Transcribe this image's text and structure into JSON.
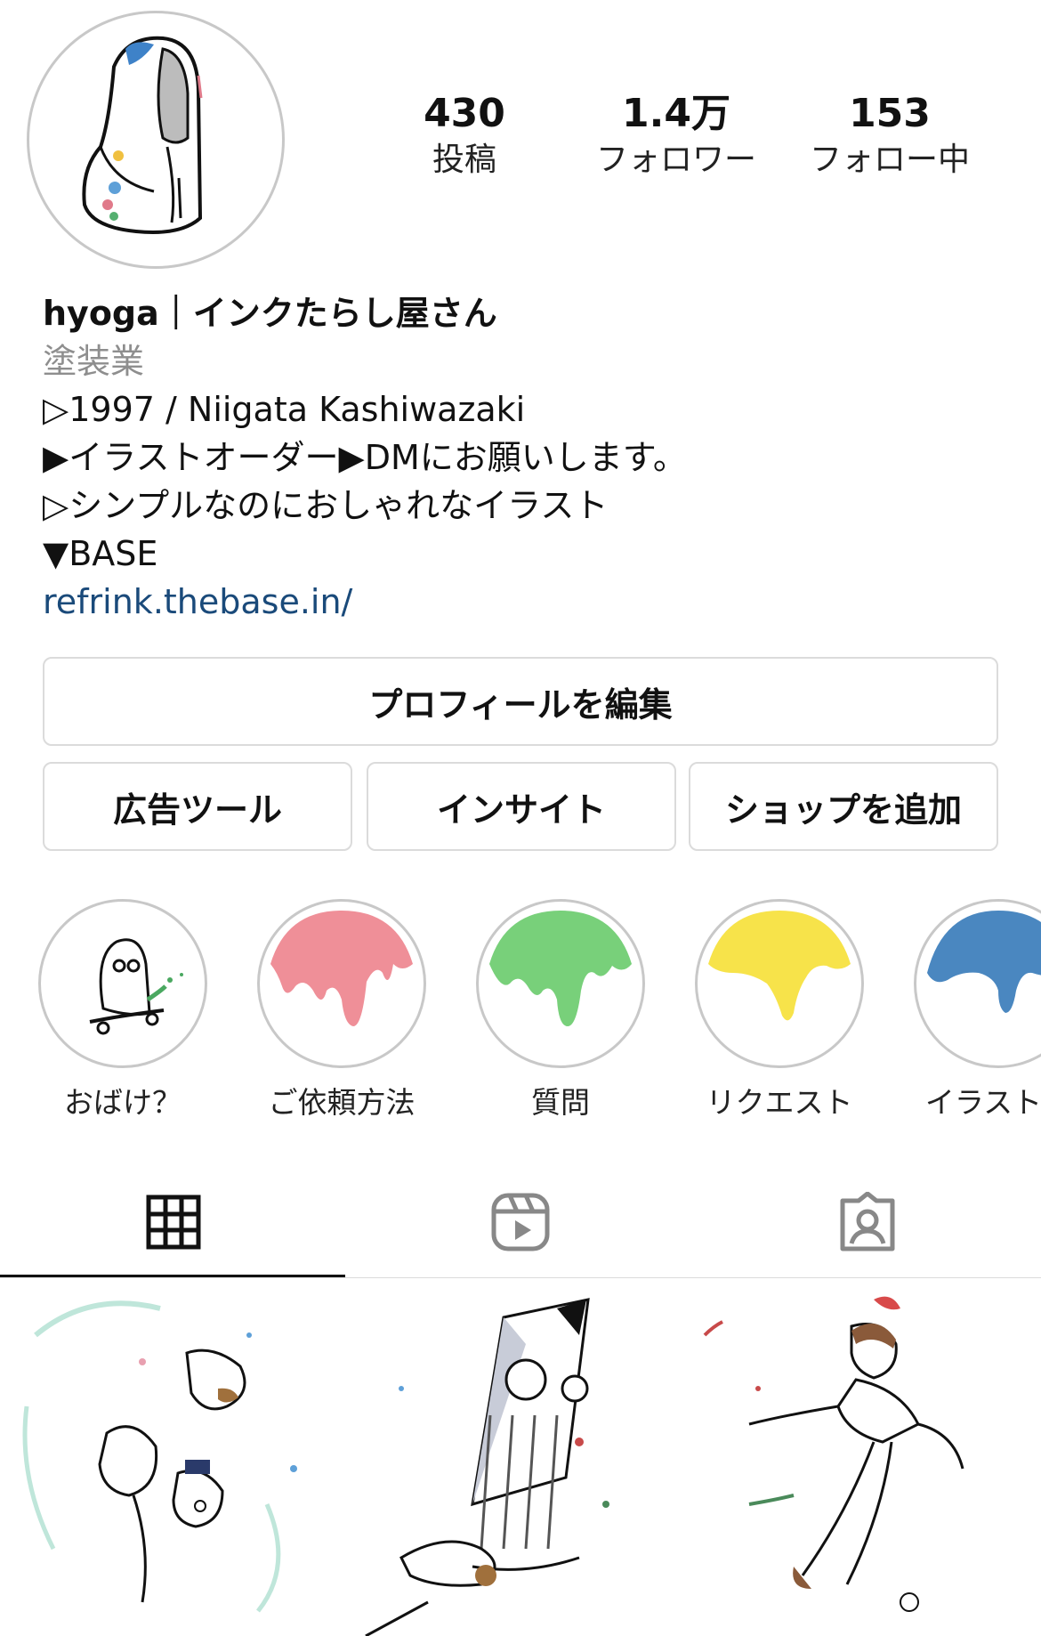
{
  "profile": {
    "stats": {
      "posts": {
        "value": "430",
        "label": "投稿"
      },
      "followers": {
        "value": "1.4万",
        "label": "フォロワー"
      },
      "following": {
        "value": "153",
        "label": "フォロー中"
      }
    },
    "bio": {
      "name": "hyoga｜インクたらし屋さん",
      "category": "塗装業",
      "line1": "▷1997 / Niigata Kashiwazaki",
      "line2": "▶イラストオーダー▶DMにお願いします。",
      "line3": "▷シンプルなのにおしゃれなイラスト",
      "line4": "▼BASE",
      "link": "refrink.thebase.in/"
    }
  },
  "buttons": {
    "edit_profile": "プロフィールを編集",
    "ad_tools": "広告ツール",
    "insights": "インサイト",
    "add_shop": "ショップを追加"
  },
  "highlights": [
    {
      "label": "おばけ？",
      "icon": "ghost-skateboard-icon"
    },
    {
      "label": "ご依頼方法",
      "color": "#ef8f98"
    },
    {
      "label": "質問",
      "color": "#78d07a"
    },
    {
      "label": "リクエスト",
      "color": "#f7e34a"
    },
    {
      "label": "イラストの",
      "color": "#4a87c0"
    }
  ],
  "tabs": {
    "grid": "grid-icon",
    "reels": "reels-icon",
    "tagged": "tagged-icon"
  },
  "posts": [
    {
      "subject": "flying-characters-illustration"
    },
    {
      "subject": "clock-tower-illustration"
    },
    {
      "subject": "flying-boy-illustration"
    }
  ]
}
